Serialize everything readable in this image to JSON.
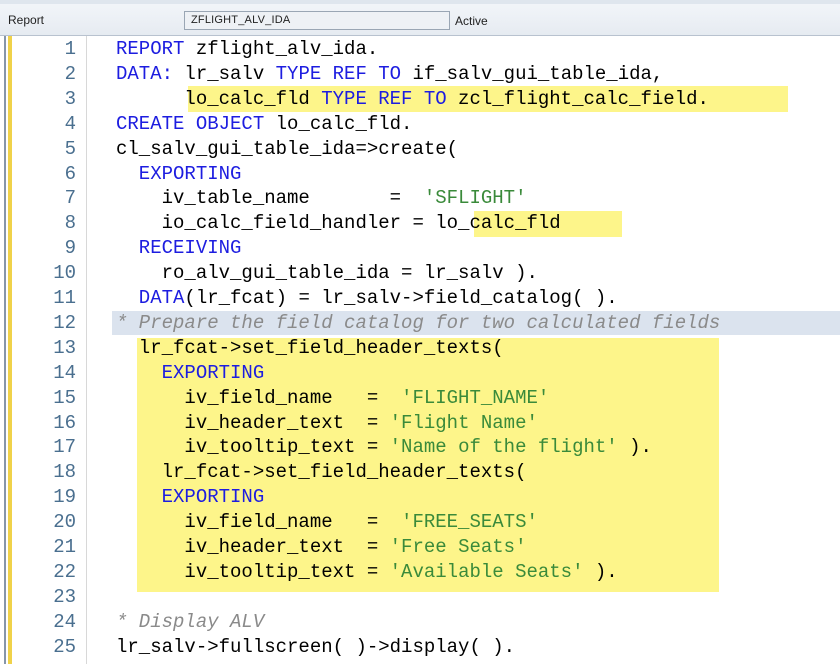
{
  "header": {
    "object_type_label": "Report",
    "program_name": "ZFLIGHT_ALV_IDA",
    "status": "Active"
  },
  "colors": {
    "keyword": "#1d1de0",
    "string": "#3a8a3a",
    "comment": "#8a8a8a",
    "highlight": "#fdf58a",
    "line_number": "#4a6f8f"
  },
  "lines": [
    {
      "n": "1",
      "t": [
        [
          "k",
          "REPORT"
        ],
        [
          "p",
          " zflight_alv_ida."
        ]
      ]
    },
    {
      "n": "2",
      "t": [
        [
          "k",
          "DATA:"
        ],
        [
          "p",
          " lr_salv "
        ],
        [
          "k",
          "TYPE REF TO"
        ],
        [
          "p",
          " if_salv_gui_table_ida,"
        ]
      ]
    },
    {
      "n": "3",
      "t": [
        [
          "p",
          "      lo_calc_fld "
        ],
        [
          "k",
          "TYPE REF TO"
        ],
        [
          "p",
          " zcl_flight_calc_field."
        ]
      ]
    },
    {
      "n": "4",
      "t": [
        [
          "k",
          "CREATE OBJECT"
        ],
        [
          "p",
          " lo_calc_fld."
        ]
      ]
    },
    {
      "n": "5",
      "t": [
        [
          "p",
          "cl_salv_gui_table_ida=>create("
        ]
      ]
    },
    {
      "n": "6",
      "t": [
        [
          "k",
          "  EXPORTING"
        ]
      ]
    },
    {
      "n": "7",
      "t": [
        [
          "p",
          "    iv_table_name       =  "
        ],
        [
          "s",
          "'SFLIGHT'"
        ]
      ]
    },
    {
      "n": "8",
      "t": [
        [
          "p",
          "    io_calc_field_handler = lo_calc_fld"
        ]
      ]
    },
    {
      "n": "9",
      "t": [
        [
          "k",
          "  RECEIVING"
        ]
      ]
    },
    {
      "n": "10",
      "t": [
        [
          "p",
          "    ro_alv_gui_table_ida = lr_salv )."
        ]
      ]
    },
    {
      "n": "11",
      "t": [
        [
          "k",
          "  DATA"
        ],
        [
          "p",
          "(lr_fcat) = lr_salv->field_catalog( )."
        ]
      ]
    },
    {
      "n": "12",
      "t": [
        [
          "c",
          "* Prepare the field catalog for two calculated fields"
        ]
      ]
    },
    {
      "n": "13",
      "t": [
        [
          "p",
          "  lr_fcat->set_field_header_texts("
        ]
      ]
    },
    {
      "n": "14",
      "t": [
        [
          "k",
          "    EXPORTING"
        ]
      ]
    },
    {
      "n": "15",
      "t": [
        [
          "p",
          "      iv_field_name   =  "
        ],
        [
          "s",
          "'FLIGHT_NAME'"
        ]
      ]
    },
    {
      "n": "16",
      "t": [
        [
          "p",
          "      iv_header_text  = "
        ],
        [
          "s",
          "'Flight Name'"
        ]
      ]
    },
    {
      "n": "17",
      "t": [
        [
          "p",
          "      iv_tooltip_text = "
        ],
        [
          "s",
          "'Name of the flight'"
        ],
        [
          "p",
          " )."
        ]
      ]
    },
    {
      "n": "18",
      "t": [
        [
          "p",
          "    lr_fcat->set_field_header_texts("
        ]
      ]
    },
    {
      "n": "19",
      "t": [
        [
          "k",
          "    EXPORTING"
        ]
      ]
    },
    {
      "n": "20",
      "t": [
        [
          "p",
          "      iv_field_name   =  "
        ],
        [
          "s",
          "'FREE_SEATS'"
        ]
      ]
    },
    {
      "n": "21",
      "t": [
        [
          "p",
          "      iv_header_text  = "
        ],
        [
          "s",
          "'Free Seats'"
        ]
      ]
    },
    {
      "n": "22",
      "t": [
        [
          "p",
          "      iv_tooltip_text = "
        ],
        [
          "s",
          "'Available Seats'"
        ],
        [
          "p",
          " )."
        ]
      ]
    },
    {
      "n": "23",
      "t": []
    },
    {
      "n": "24",
      "t": [
        [
          "c",
          "* Display ALV"
        ]
      ]
    },
    {
      "n": "25",
      "t": [
        [
          "p",
          "lr_salv->fullscreen( )->display( )."
        ]
      ]
    }
  ]
}
